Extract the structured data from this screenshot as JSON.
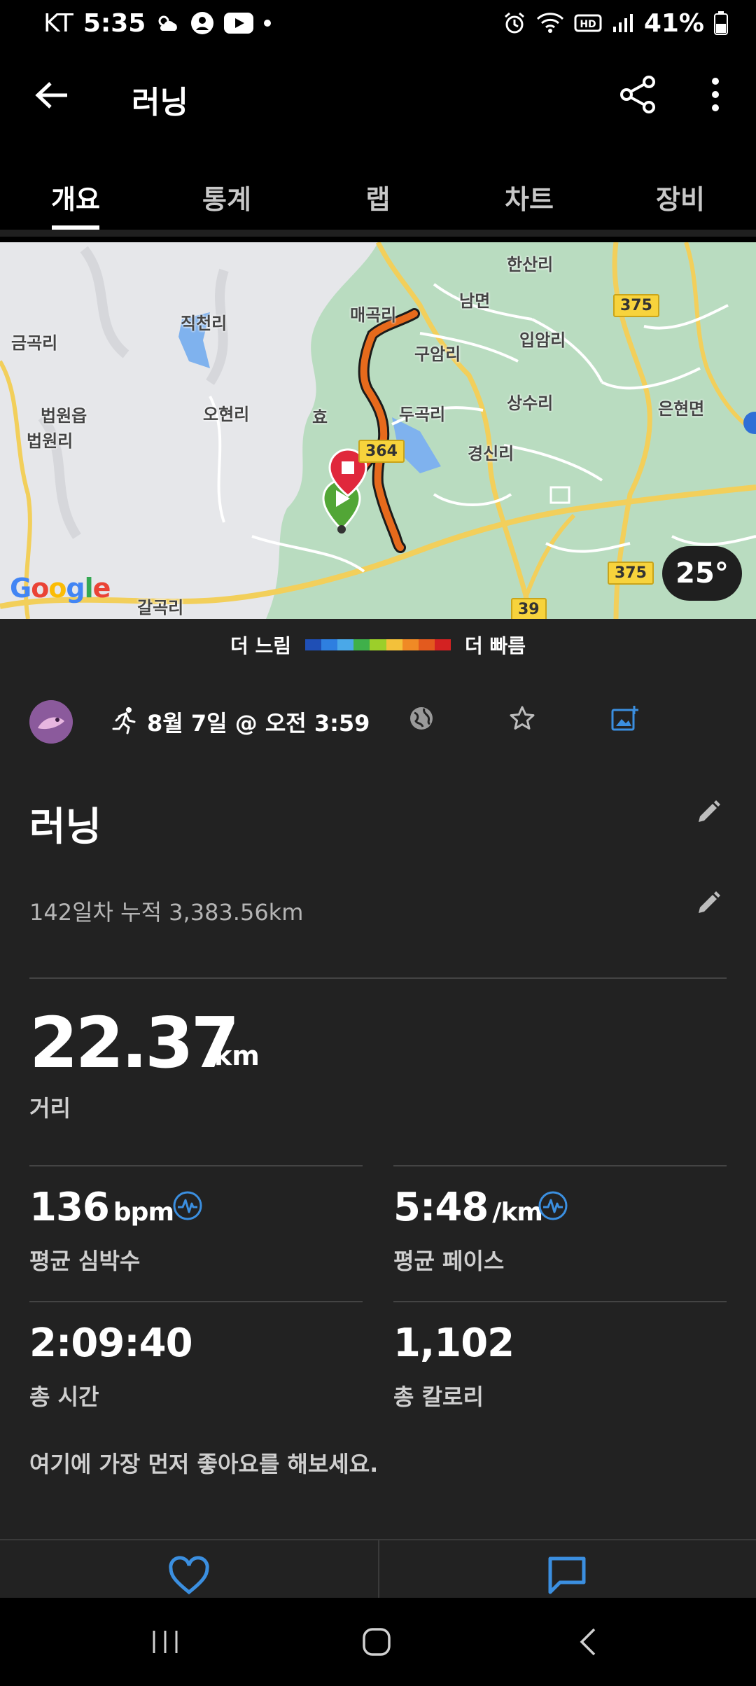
{
  "status_bar": {
    "carrier": "KT",
    "time": "5:35",
    "battery": "41%"
  },
  "app_bar": {
    "title": "러닝"
  },
  "tabs": [
    {
      "label": "개요",
      "active": true
    },
    {
      "label": "통계",
      "active": false
    },
    {
      "label": "랩",
      "active": false
    },
    {
      "label": "차트",
      "active": false
    },
    {
      "label": "장비",
      "active": false
    }
  ],
  "map": {
    "labels": {
      "hansanri": "한산리",
      "namyeon": "남면",
      "maegokri": "매곡리",
      "jikcheonri": "직천리",
      "geumgokri": "금곡리",
      "ipamri": "입암리",
      "guamri": "구암리",
      "dugokri": "두곡리",
      "sangsuri": "상수리",
      "eunhyeonmyeon": "은현면",
      "beobwoneup": "법원읍",
      "beobwonri": "법원리",
      "ohyeonri": "오현리",
      "gyeongsinri": "경신리",
      "galgokri": "갈곡리",
      "hyo": "효"
    },
    "road_signs": {
      "r375_top": "375",
      "r364": "364",
      "r375_bottom": "375",
      "r39": "39"
    },
    "google_logo": "Google",
    "temperature": "25°"
  },
  "legend": {
    "slower": "더 느림",
    "faster": "더 빠름",
    "colors": [
      "#1f4fb5",
      "#2e7fe0",
      "#4aa8e8",
      "#3fb04a",
      "#9ccf2a",
      "#f3c13a",
      "#f08a25",
      "#e35a1e",
      "#d32222"
    ]
  },
  "activity": {
    "date": "8월 7일 @ 오전 3:59",
    "title": "러닝",
    "cumulative": "142일차 누적 3,383.56km",
    "distance": {
      "value": "22.37",
      "unit": "km",
      "label": "거리"
    },
    "heart_rate": {
      "value": "136",
      "unit": "bpm",
      "label": "평균 심박수"
    },
    "pace": {
      "value": "5:48",
      "unit": "/km",
      "label": "평균 페이스"
    },
    "time": {
      "value": "2:09:40",
      "label": "총 시간"
    },
    "calories": {
      "value": "1,102",
      "label": "총 칼로리"
    },
    "like_prompt": "여기에 가장 먼저 좋아요를 해보세요."
  },
  "colors": {
    "accent": "#3b8fe0",
    "background": "#222222",
    "route": "#e66a1c",
    "start_pin": "#52a636",
    "stop_pin": "#e0283c"
  }
}
